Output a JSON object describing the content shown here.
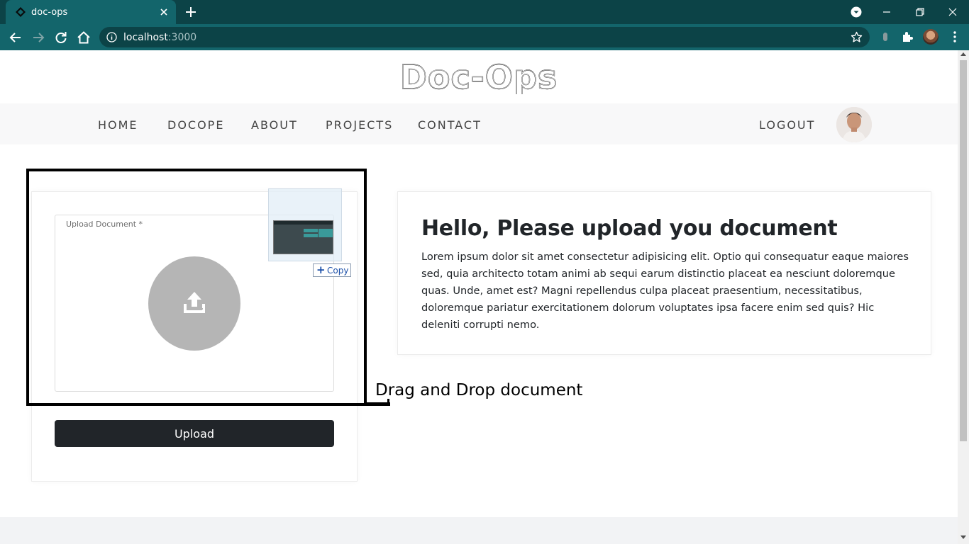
{
  "browser": {
    "tab_title": "doc-ops",
    "url_host": "localhost",
    "url_port": ":3000"
  },
  "site": {
    "logo_text": "Doc-Ops",
    "nav": [
      "HOME",
      "DOCOPE",
      "ABOUT",
      "PROJECTS",
      "CONTACT"
    ],
    "logout": "LOGOUT"
  },
  "upload": {
    "field_label": "Upload Document *",
    "button_label": "Upload",
    "drag_badge": "Copy"
  },
  "info": {
    "heading": "Hello, Please upload you document",
    "body": "Lorem ipsum dolor sit amet consectetur adipisicing elit. Optio qui consequatur eaque maiores sed, quia architecto totam animi ab sequi earum distinctio placeat ea nesciunt doloremque quas. Unde, amet est? Magni repellendus culpa placeat praesentium, necessitatibus, doloremque pariatur exercitationem dolorum voluptates ipsa facere enim sed quis? Hic deleniti corrupti nemo."
  },
  "annotation": {
    "text": "Drag and Drop document"
  },
  "colors": {
    "chrome_dark": "#0c4347",
    "chrome_teal": "#13656b",
    "button_dark": "#212529",
    "upload_circle": "#b5b5b5"
  },
  "icons": [
    "doc-ops-favicon",
    "close-icon",
    "plus-icon",
    "tab-search-icon",
    "minimize-icon",
    "restore-icon",
    "window-close-icon",
    "back-icon",
    "forward-icon",
    "reload-icon",
    "home-icon",
    "info-icon",
    "star-icon",
    "extension-icon",
    "puzzle-icon",
    "kebab-menu-icon",
    "upload-icon"
  ]
}
